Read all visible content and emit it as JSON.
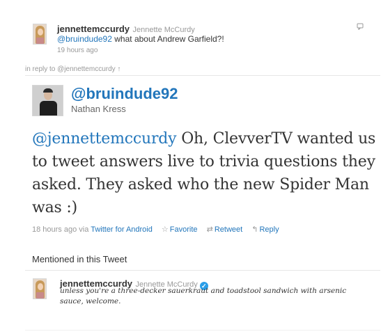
{
  "top_tweet": {
    "username": "jennettemccurdy",
    "fullname": "Jennette McCurdy",
    "mention": "@bruindude92",
    "text": " what about Andrew Garfield?!",
    "time": "19 hours ago"
  },
  "in_reply_to": "in reply to @jennettemccurdy ↑",
  "main_tweet": {
    "handle": "@bruindude92",
    "fullname": "Nathan Kress",
    "mention": "@jennettemccurdy",
    "text": " Oh, ClevverTV wanted us to tweet answers live to trivia questions they asked. They asked who the new Spider Man was :)",
    "time": "18 hours ago",
    "via_label": "via",
    "source": "Twitter for Android",
    "favorite_label": "Favorite",
    "retweet_label": "Retweet",
    "reply_label": "Reply",
    "favorite_icon": "☆",
    "retweet_icon": "⇄",
    "reply_icon": "↰"
  },
  "mentioned_title": "Mentioned in this Tweet",
  "mentioned_user": {
    "username": "jennettemccurdy",
    "fullname": "Jennette McCurdy",
    "verified_icon": "✓",
    "bio": "unless you're a three-decker sauerkraut and toadstool sandwich with arsenic sauce, welcome."
  },
  "colors": {
    "link": "#2276bb",
    "muted": "#999999",
    "text": "#333333",
    "verified": "#2b9ee8"
  }
}
